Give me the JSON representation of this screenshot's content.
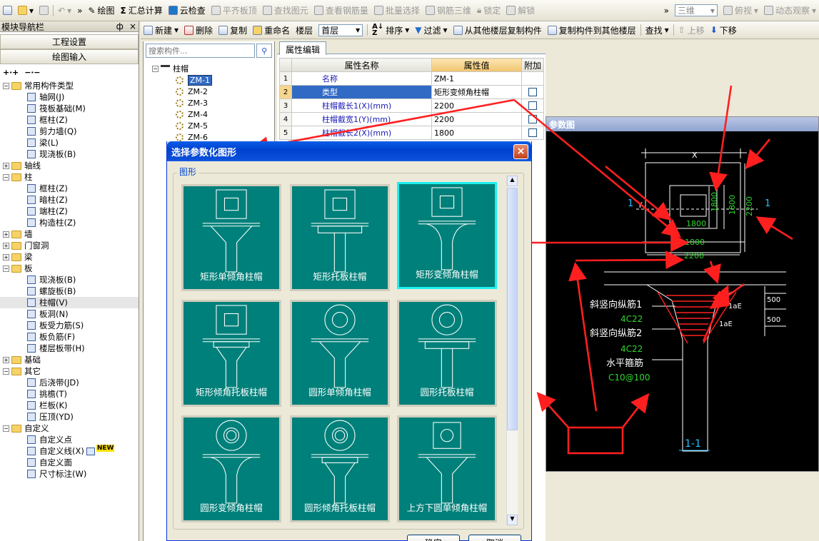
{
  "toolbar1": {
    "draw": "绘图",
    "sum_calc": "汇总计算",
    "cloud_check": "云检查",
    "align_top": "平齐板顶",
    "find_element": "查找图元",
    "view_rebar": "查看钢筋量",
    "batch_select": "批量选择",
    "rebar_3d": "钢筋三维",
    "lock": "锁定",
    "unlock": "解锁",
    "view_mode": "三维",
    "view_dir": "俯视",
    "dynamic_view": "动态观察"
  },
  "nav": {
    "title": "模块导航栏",
    "pin": "ф",
    "close": "×",
    "btn_project": "工程设置",
    "btn_draw": "绘图输入",
    "tree": [
      {
        "label": "常用构件类型",
        "level": 0,
        "exp": "−"
      },
      {
        "label": "轴网(J)",
        "level": 1
      },
      {
        "label": "筏板基础(M)",
        "level": 1
      },
      {
        "label": "框柱(Z)",
        "level": 1
      },
      {
        "label": "剪力墙(Q)",
        "level": 1
      },
      {
        "label": "梁(L)",
        "level": 1
      },
      {
        "label": "现浇板(B)",
        "level": 1
      },
      {
        "label": "轴线",
        "level": 0,
        "exp": "+"
      },
      {
        "label": "柱",
        "level": 0,
        "exp": "−"
      },
      {
        "label": "框柱(Z)",
        "level": 1
      },
      {
        "label": "暗柱(Z)",
        "level": 1
      },
      {
        "label": "端柱(Z)",
        "level": 1
      },
      {
        "label": "构造柱(Z)",
        "level": 1
      },
      {
        "label": "墙",
        "level": 0,
        "exp": "+"
      },
      {
        "label": "门窗洞",
        "level": 0,
        "exp": "+"
      },
      {
        "label": "梁",
        "level": 0,
        "exp": "+"
      },
      {
        "label": "板",
        "level": 0,
        "exp": "−"
      },
      {
        "label": "现浇板(B)",
        "level": 1
      },
      {
        "label": "螺旋板(B)",
        "level": 1
      },
      {
        "label": "柱帽(V)",
        "level": 1,
        "selected": true
      },
      {
        "label": "板洞(N)",
        "level": 1
      },
      {
        "label": "板受力筋(S)",
        "level": 1
      },
      {
        "label": "板负筋(F)",
        "level": 1
      },
      {
        "label": "楼层板带(H)",
        "level": 1
      },
      {
        "label": "基础",
        "level": 0,
        "exp": "+"
      },
      {
        "label": "其它",
        "level": 0,
        "exp": "−"
      },
      {
        "label": "后浇带(JD)",
        "level": 1
      },
      {
        "label": "挑檐(T)",
        "level": 1
      },
      {
        "label": "栏板(K)",
        "level": 1
      },
      {
        "label": "压顶(YD)",
        "level": 1
      },
      {
        "label": "自定义",
        "level": 0,
        "exp": "−"
      },
      {
        "label": "自定义点",
        "level": 1
      },
      {
        "label": "自定义线(X)",
        "level": 1,
        "badge": "NEW"
      },
      {
        "label": "自定义面",
        "level": 1
      },
      {
        "label": "尺寸标注(W)",
        "level": 1
      }
    ]
  },
  "toolbar2": {
    "new": "新建",
    "delete": "删除",
    "copy": "复制",
    "rename": "重命名",
    "floor_label": "楼层",
    "floor_value": "首层",
    "sort": "排序",
    "filter": "过滤",
    "copy_from": "从其他楼层复制构件",
    "copy_to": "复制构件到其他楼层",
    "find": "查找",
    "move_up": "上移",
    "move_down": "下移"
  },
  "component_list": {
    "search_placeholder": "搜索构件...",
    "root": "柱帽",
    "items": [
      "ZM-1",
      "ZM-2",
      "ZM-3",
      "ZM-4",
      "ZM-5",
      "ZM-6"
    ]
  },
  "property_panel": {
    "tab": "属性编辑",
    "headers": [
      "属性名称",
      "属性值",
      "附加"
    ],
    "rows": [
      {
        "no": "1",
        "name": "名称",
        "value": "ZM-1",
        "check": false
      },
      {
        "no": "2",
        "name": "类型",
        "value": "矩形变倾角柱帽",
        "check": true
      },
      {
        "no": "3",
        "name": "柱帽截长1(X)(mm)",
        "value": "2200",
        "check": true
      },
      {
        "no": "4",
        "name": "柱帽截宽1(Y)(mm)",
        "value": "2200",
        "check": true
      },
      {
        "no": "5",
        "name": "柱帽截长2(X)(mm)",
        "value": "1800",
        "check": true
      }
    ]
  },
  "param_window": {
    "title": "参数图",
    "labels": {
      "x": "X",
      "y": "Y",
      "sec1": "1",
      "d1800a": "1800",
      "d1800b": "1800",
      "d1800c": "1800",
      "d1800d": "1800",
      "d2200a": "2200",
      "d2200b": "2200",
      "d500a": "500",
      "d500b": "500",
      "lae1": "1aE",
      "lae2": "1aE",
      "rebar1": "斜竖向纵筋1",
      "rebar1_val": "4C22",
      "rebar2": "斜竖向纵筋2",
      "rebar2_val": "4C22",
      "stirrup": "水平箍筋",
      "stirrup_val": "C10@100",
      "section": "1-1"
    }
  },
  "dialog": {
    "title": "选择参数化图形",
    "close": "×",
    "group_label": "图形",
    "shapes": [
      "矩形单倾角柱帽",
      "矩形托板柱帽",
      "矩形变倾角柱帽",
      "矩形倾角托板柱帽",
      "圆形单倾角柱帽",
      "圆形托板柱帽",
      "圆形变倾角柱帽",
      "圆形倾角托板柱帽",
      "上方下圆单倾角柱帽"
    ],
    "selected_index": 2,
    "ok": "确定",
    "cancel": "取消"
  },
  "colors": {
    "annotation": "#ff1f1f",
    "tile": "#00807a",
    "selected_border": "#1ef0f0",
    "cad_green": "#2fd52f"
  }
}
